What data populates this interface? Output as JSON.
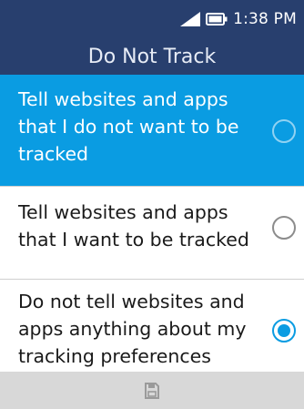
{
  "status_bar": {
    "time": "1:38 PM",
    "icons": [
      "signal-icon",
      "battery-icon"
    ]
  },
  "header": {
    "title": "Do Not Track"
  },
  "options": [
    {
      "label": "Tell websites and apps that I do not want to be tracked",
      "checked": false,
      "focused": true
    },
    {
      "label": "Tell websites and apps that I want to be tracked",
      "checked": false,
      "focused": false
    },
    {
      "label": "Do not tell websites and apps anything about my tracking preferences",
      "checked": true,
      "focused": false
    }
  ],
  "softkey_bar": {
    "center_icon": "save-icon"
  },
  "colors": {
    "header_background": "#283f6e",
    "focus_background": "#0a9ce2",
    "radio_checked": "#0a9ce2",
    "softkey_background": "#d8d8d8"
  }
}
